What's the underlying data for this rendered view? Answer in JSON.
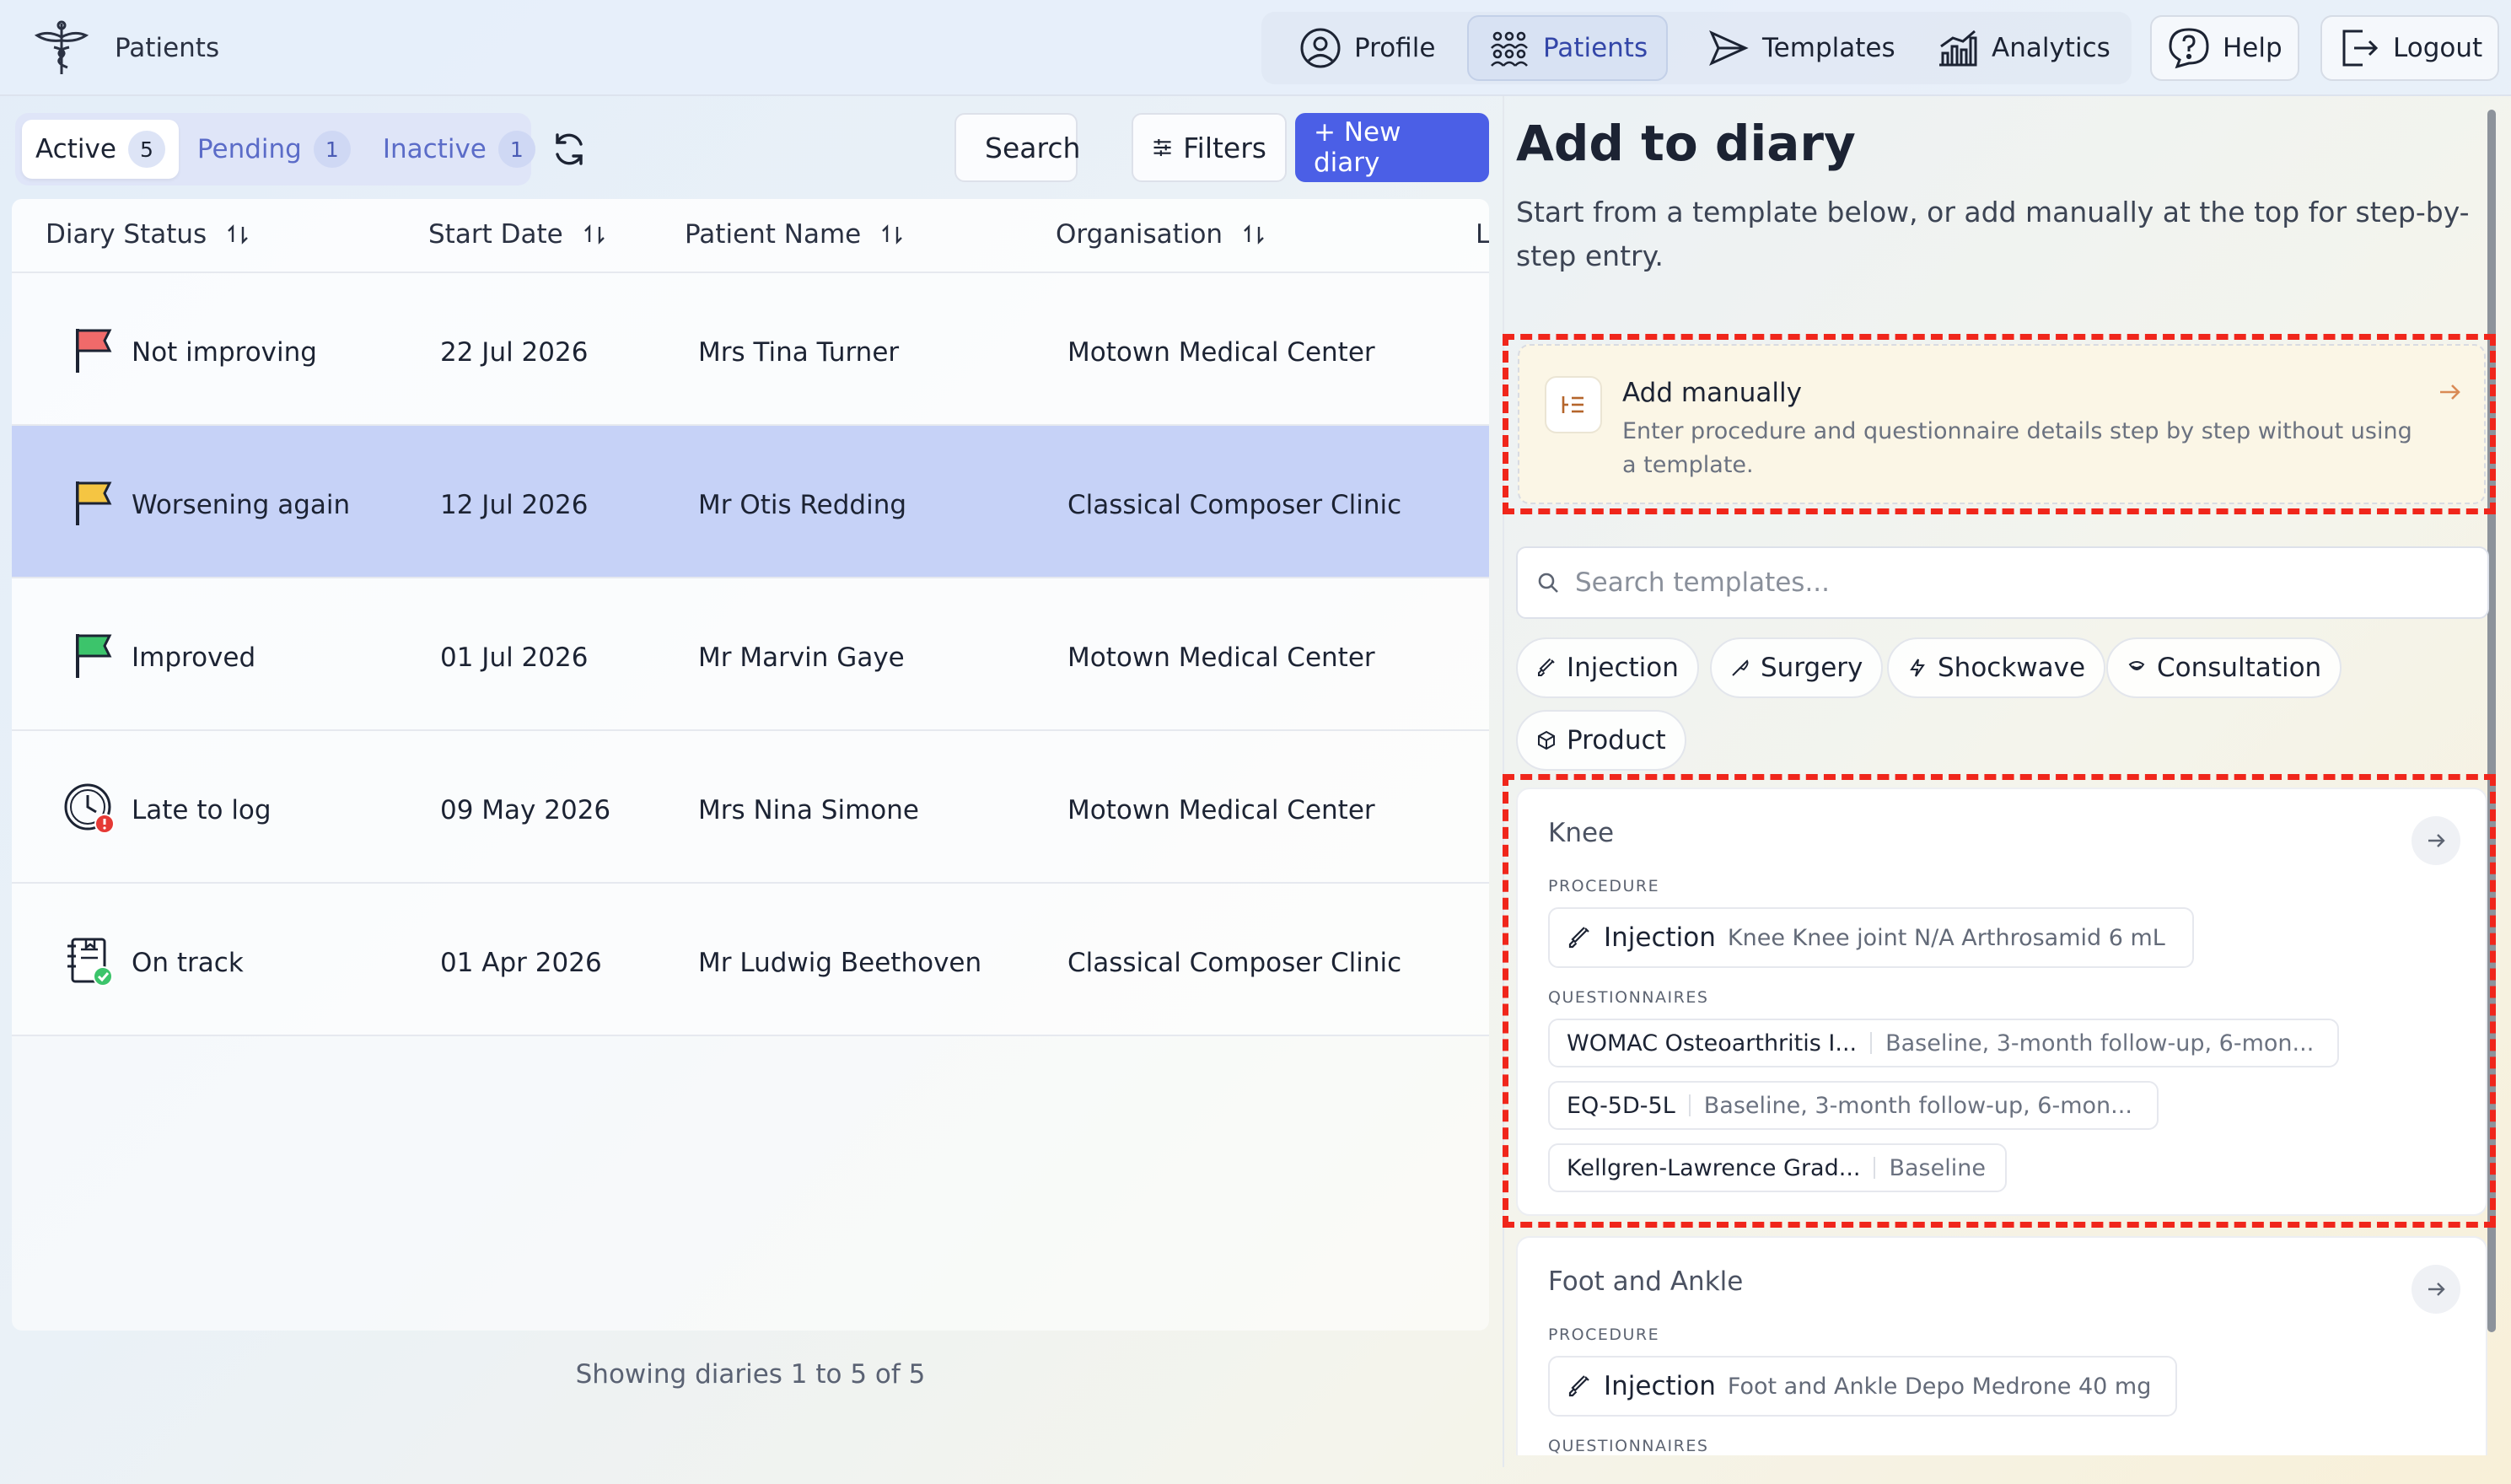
{
  "app": {
    "title": "Patients"
  },
  "nav": {
    "profile": "Profile",
    "patients": "Patients",
    "templates": "Templates",
    "analytics": "Analytics",
    "help": "Help",
    "logout": "Logout",
    "active_item": "Patients"
  },
  "tabs": [
    {
      "label": "Active",
      "count": "5",
      "active": true
    },
    {
      "label": "Pending",
      "count": "1",
      "active": false
    },
    {
      "label": "Inactive",
      "count": "1",
      "active": false
    }
  ],
  "toolbar": {
    "search": "Search",
    "filters": "Filters",
    "new_diary": "+ New diary"
  },
  "table": {
    "columns": [
      "Diary Status",
      "Start Date",
      "Patient Name",
      "Organisation",
      "L"
    ],
    "rows": [
      {
        "status": "Not improving",
        "status_icon": "red-flag-icon",
        "start_date": "22 Jul 2026",
        "patient": "Mrs Tina Turner",
        "organisation": "Motown Medical Center",
        "selected": false
      },
      {
        "status": "Worsening again",
        "status_icon": "yellow-flag-icon",
        "start_date": "12 Jul 2026",
        "patient": "Mr Otis Redding",
        "organisation": "Classical Composer Clinic",
        "selected": true
      },
      {
        "status": "Improved",
        "status_icon": "green-flag-icon",
        "start_date": "01 Jul 2026",
        "patient": "Mr Marvin Gaye",
        "organisation": "Motown Medical Center",
        "selected": false
      },
      {
        "status": "Late to log",
        "status_icon": "clock-alert-icon",
        "start_date": "09 May 2026",
        "patient": "Mrs Nina Simone",
        "organisation": "Motown Medical Center",
        "selected": false
      },
      {
        "status": "On track",
        "status_icon": "notebook-check-icon",
        "start_date": "01 Apr 2026",
        "patient": "Mr Ludwig Beethoven",
        "organisation": "Classical Composer Clinic",
        "selected": false
      }
    ],
    "footer": "Showing diaries 1 to 5 of 5"
  },
  "diary_panel": {
    "title": "Add to diary",
    "subtitle": "Start from a template below, or add manually at the top for step-by-step entry.",
    "manual": {
      "title": "Add manually",
      "description": "Enter procedure and questionnaire details step by step without using a template."
    },
    "search_placeholder": "Search templates...",
    "filters": [
      "Injection",
      "Surgery",
      "Shockwave",
      "Consultation",
      "Product"
    ],
    "procedure_label": "PROCEDURE",
    "questionnaires_label": "QUESTIONNAIRES",
    "templates": [
      {
        "name": "Knee",
        "procedure_type": "Injection",
        "procedure_detail": "Knee Knee joint N/A Arthrosamid 6 mL",
        "questionnaires": [
          {
            "name": "WOMAC Osteoarthritis I...",
            "schedule": "Baseline, 3-month follow-up, 6-mon..."
          },
          {
            "name": "EQ-5D-5L",
            "schedule": "Baseline, 3-month follow-up, 6-mon..."
          },
          {
            "name": "Kellgren-Lawrence Grad...",
            "schedule": "Baseline"
          }
        ]
      },
      {
        "name": "Foot and Ankle",
        "procedure_type": "Injection",
        "procedure_detail": "Foot and Ankle Depo Medrone 40 mg"
      }
    ]
  },
  "colors": {
    "primary": "#4b5fe6",
    "selected_row": "#c6d2f7",
    "highlight": "#f0261b",
    "flag_red": "#f06a6a",
    "flag_yellow": "#f5c542",
    "flag_green": "#3cc46b"
  }
}
